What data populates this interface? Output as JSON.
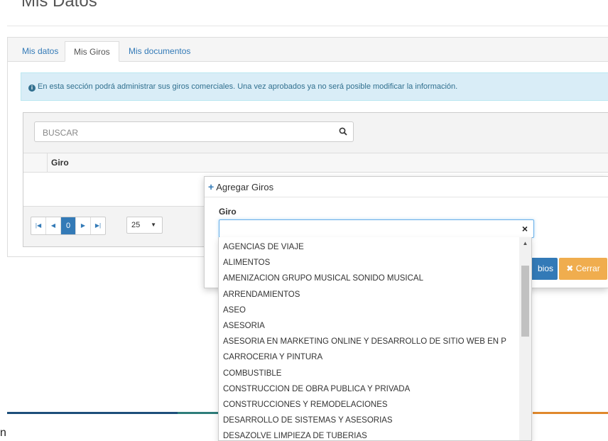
{
  "page": {
    "title": "Mis Datos",
    "corner_char": "n"
  },
  "tabs": [
    {
      "label": "Mis datos"
    },
    {
      "label": "Mis Giros"
    },
    {
      "label": "Mis documentos"
    }
  ],
  "alert": {
    "text": "En esta sección podrá administrar sus giros comerciales. Una vez aprobados ya no será posible modificar la información."
  },
  "grid": {
    "search_placeholder": "BUSCAR",
    "column": "Giro",
    "pager": {
      "current_page": "0",
      "page_size": "25"
    }
  },
  "modal": {
    "title": "Agregar Giros",
    "field_label": "Giro",
    "input_value": "",
    "save_label": "bios",
    "close_label": "Cerrar"
  },
  "dropdown": {
    "options": [
      "AGENCIAS DE VIAJE",
      "ALIMENTOS",
      "AMENIZACION GRUPO MUSICAL SONIDO MUSICAL",
      "ARRENDAMIENTOS",
      "ASEO",
      "ASESORIA",
      "ASESORIA EN MARKETING ONLINE Y DESARROLLO DE SITIO WEB EN P",
      "CARROCERIA Y PINTURA",
      "COMBUSTIBLE",
      "CONSTRUCCION DE OBRA PUBLICA Y PRIVADA",
      "CONSTRUCCIONES Y REMODELACIONES",
      "DESARROLLO DE SISTEMAS Y ASESORIAS",
      "DESAZOLVE LIMPIEZA DE TUBERIAS"
    ]
  },
  "colors": {
    "primary": "#337ab7",
    "warning": "#f0ad4e",
    "info_bg": "#d9edf7",
    "info_text": "#31708f"
  }
}
